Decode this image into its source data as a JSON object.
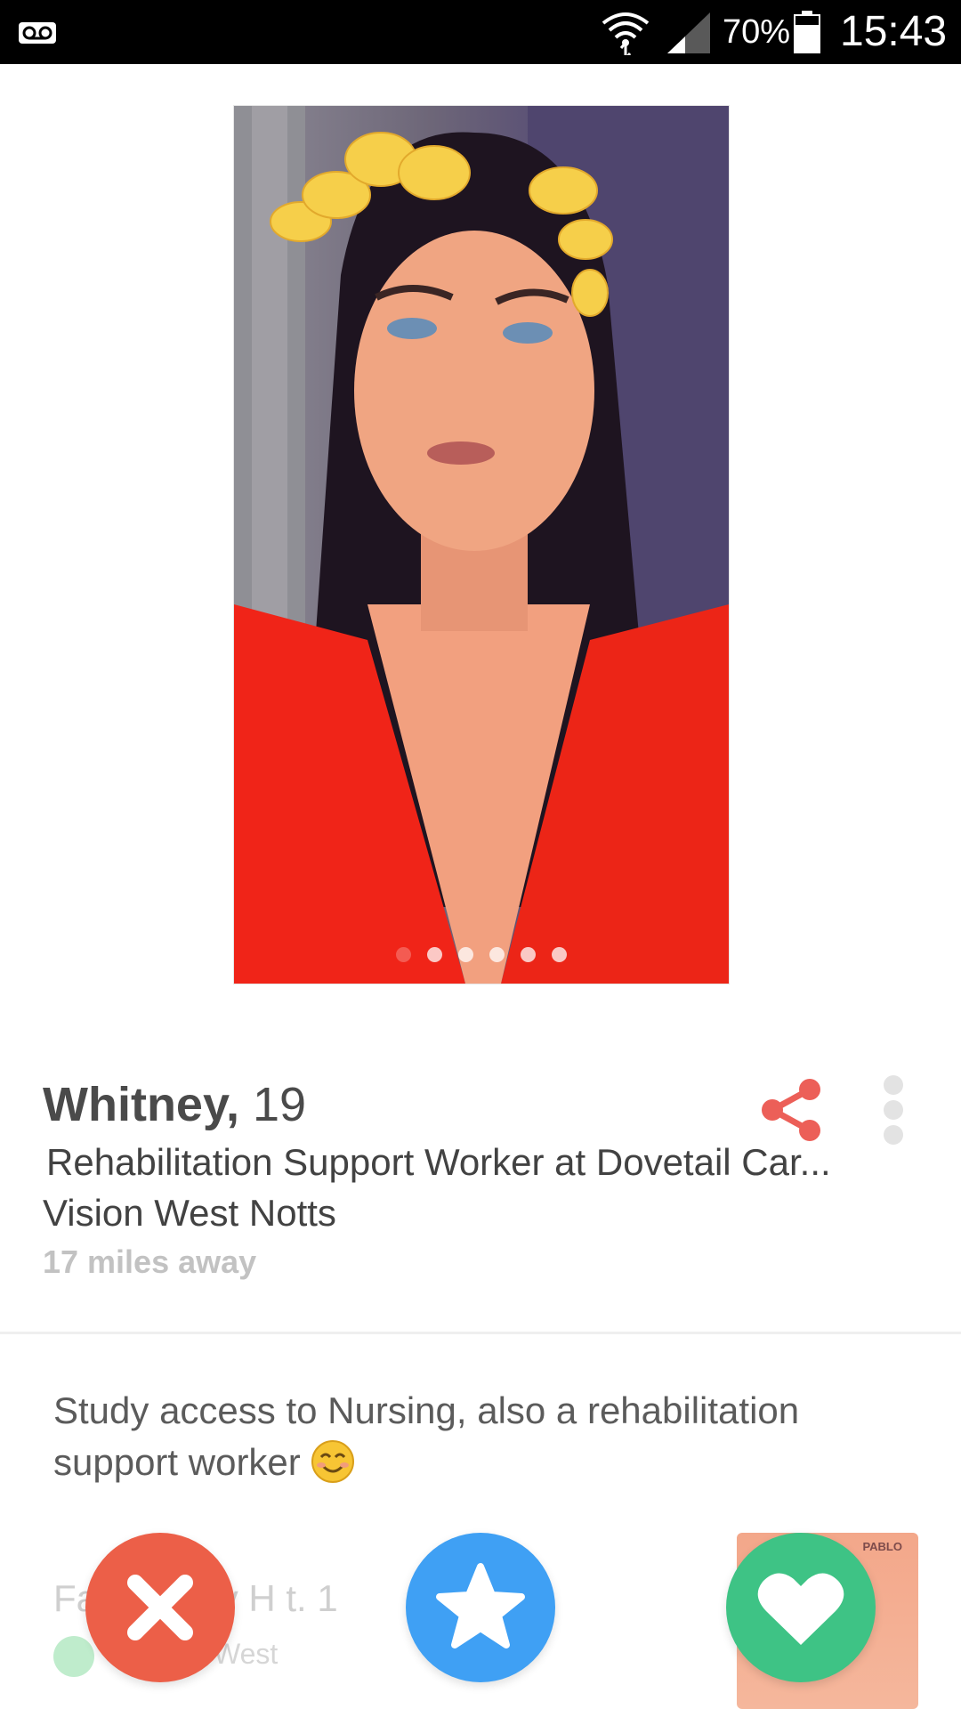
{
  "status_bar": {
    "battery_percent": "70%",
    "time": "15:43",
    "icons": [
      "voicemail-icon",
      "wifi-icon",
      "signal-icon",
      "battery-icon"
    ]
  },
  "photo": {
    "description_icon": "profile-photo",
    "photo_count": 6,
    "active_index": 0
  },
  "profile": {
    "name": "Whitney,",
    "age": "19",
    "job": "Rehabilitation Support Worker at Dovetail Car...",
    "school": "Vision West Notts",
    "distance": "17 miles away",
    "bio": "Study access to Nursing, also a rehabilitation support worker"
  },
  "anthem": {
    "song": "Fa       etch My H        t. 1",
    "artist": "West",
    "album_label": "PABLO"
  },
  "actions": {
    "nope": "close-icon",
    "superlike": "star-icon",
    "like": "heart-icon"
  },
  "colors": {
    "nope": "#ec5f48",
    "superlike": "#3fa0f4",
    "like": "#3ec385",
    "share": "#ec5f58"
  }
}
